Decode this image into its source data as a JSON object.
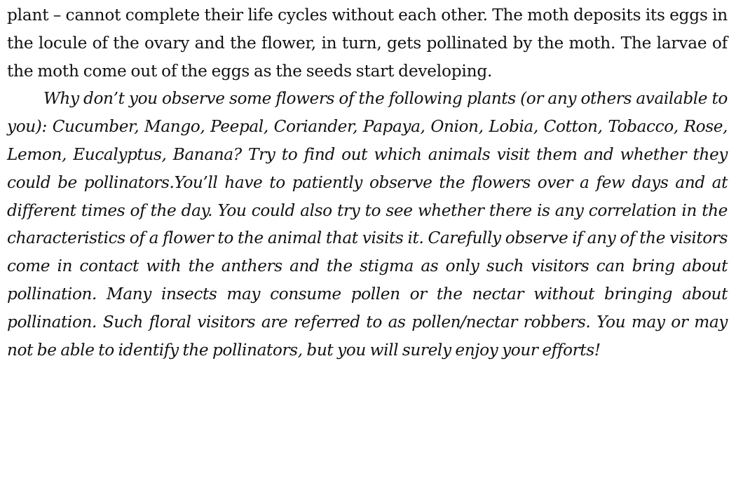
{
  "document": {
    "paragraphs": [
      "plant – cannot complete their life cycles without each other. The moth deposits its eggs in the locule of the ovary and the flower, in turn, gets pollinated by the moth.  The larvae of the moth come out of the eggs as the seeds start developing.",
      "Why don’t you observe some flowers of the following plants (or any others available to you): Cucumber, Mango, Peepal, Coriander, Papaya, Onion, Lobia, Cotton, Tobacco, Rose, Lemon, Eucalyptus, Banana? Try to find out which animals visit them and whether they could be pollinators.You’ll have to patiently observe the flowers over a few days and at different times of the day.  You could also try to see whether there is any correlation in the characteristics of a flower to the animal that visits it. Carefully observe if any of the visitors come in contact with the anthers and the stigma as only such visitors can bring about pollination. Many insects may consume pollen or the nectar without bringing about pollination. Such floral visitors are referred to as pollen/nectar robbers. You may or may not be able to identify the pollinators, but you will surely enjoy your efforts!"
    ]
  }
}
